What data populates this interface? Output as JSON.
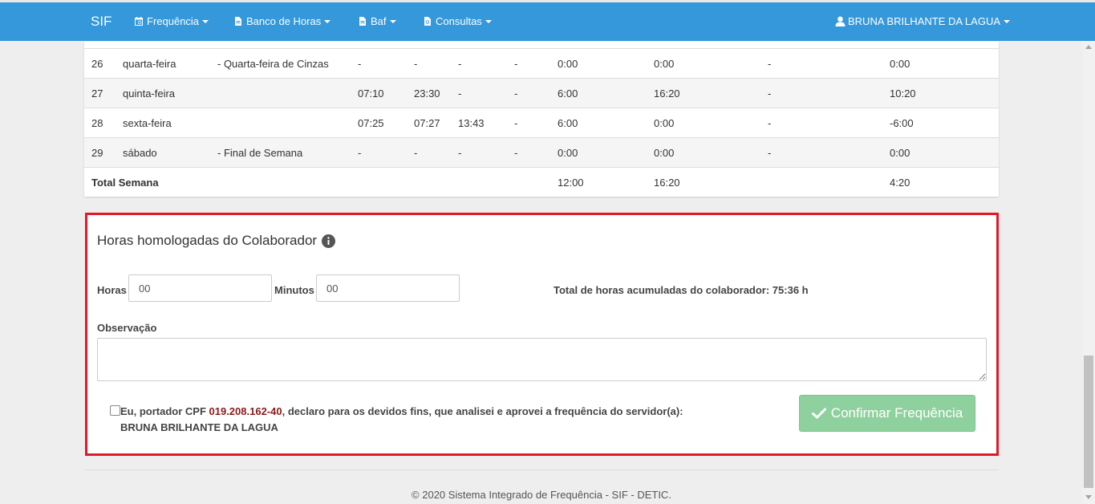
{
  "navbar": {
    "brand": "SIF",
    "menu": [
      {
        "label": "Frequência",
        "icon": "calendar-icon"
      },
      {
        "label": "Banco de Horas",
        "icon": "document-icon"
      },
      {
        "label": "Baf",
        "icon": "document-icon"
      },
      {
        "label": "Consultas",
        "icon": "document-search-icon"
      }
    ],
    "user": "BRUNA BRILHANTE DA LAGUA"
  },
  "table": {
    "rows": [
      {
        "day": "26",
        "weekday": "quarta-feira",
        "note": "- Quarta-feira de Cinzas",
        "e1": "-",
        "s1": "-",
        "e2": "-",
        "s2": "-",
        "previstas": "0:00",
        "trabalhadas": "0:00",
        "abono": "-",
        "saldo": "0:00"
      },
      {
        "day": "27",
        "weekday": "quinta-feira",
        "note": "",
        "e1": "07:10",
        "s1": "23:30",
        "e2": "-",
        "s2": "-",
        "previstas": "6:00",
        "trabalhadas": "16:20",
        "abono": "-",
        "saldo": "10:20"
      },
      {
        "day": "28",
        "weekday": "sexta-feira",
        "note": "",
        "e1": "07:25",
        "s1": "07:27",
        "e2": "13:43",
        "s2": "-",
        "previstas": "6:00",
        "trabalhadas": "0:00",
        "abono": "-",
        "saldo": "-6:00"
      },
      {
        "day": "29",
        "weekday": "sábado",
        "note": "- Final de Semana",
        "e1": "-",
        "s1": "-",
        "e2": "-",
        "s2": "-",
        "previstas": "0:00",
        "trabalhadas": "0:00",
        "abono": "-",
        "saldo": "0:00"
      }
    ],
    "total": {
      "label": "Total Semana",
      "previstas": "12:00",
      "trabalhadas": "16:20",
      "saldo": "4:20"
    }
  },
  "approval": {
    "title": "Horas homologadas do Colaborador",
    "hours_label": "Horas",
    "hours_value": "00",
    "minutes_label": "Minutos",
    "minutes_value": "00",
    "accumulated": "Total de horas acumuladas do colaborador: 75:36 h",
    "observation_label": "Observação",
    "declaration_prefix": "Eu, portador CPF ",
    "cpf": "019.208.162-40",
    "declaration_suffix": ", declaro para os devidos fins, que analisei e aprovei a frequência do servidor(a):",
    "servant_name": "BRUNA BRILHANTE DA LAGUA",
    "confirm_label": "Confirmar Frequência",
    "accent_color": "#e0192a",
    "button_color": "#8fd19e"
  },
  "footer": {
    "text": "© 2020 Sistema Integrado de Frequência - SIF - DETIC."
  }
}
